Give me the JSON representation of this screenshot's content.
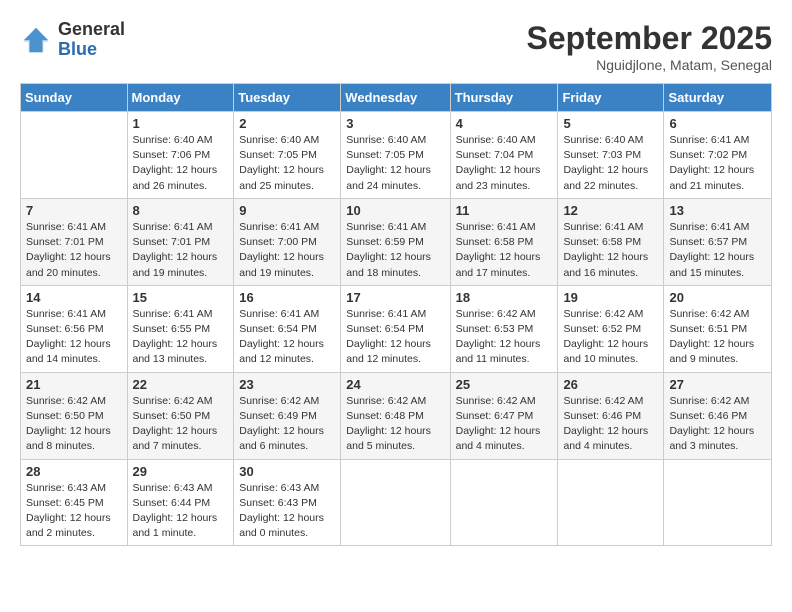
{
  "header": {
    "logo_general": "General",
    "logo_blue": "Blue",
    "month_title": "September 2025",
    "location": "Nguidjlone, Matam, Senegal"
  },
  "days_of_week": [
    "Sunday",
    "Monday",
    "Tuesday",
    "Wednesday",
    "Thursday",
    "Friday",
    "Saturday"
  ],
  "weeks": [
    [
      {
        "day": null
      },
      {
        "day": 1,
        "sunrise": "6:40 AM",
        "sunset": "7:06 PM",
        "daylight": "12 hours and 26 minutes."
      },
      {
        "day": 2,
        "sunrise": "6:40 AM",
        "sunset": "7:05 PM",
        "daylight": "12 hours and 25 minutes."
      },
      {
        "day": 3,
        "sunrise": "6:40 AM",
        "sunset": "7:05 PM",
        "daylight": "12 hours and 24 minutes."
      },
      {
        "day": 4,
        "sunrise": "6:40 AM",
        "sunset": "7:04 PM",
        "daylight": "12 hours and 23 minutes."
      },
      {
        "day": 5,
        "sunrise": "6:40 AM",
        "sunset": "7:03 PM",
        "daylight": "12 hours and 22 minutes."
      },
      {
        "day": 6,
        "sunrise": "6:41 AM",
        "sunset": "7:02 PM",
        "daylight": "12 hours and 21 minutes."
      }
    ],
    [
      {
        "day": 7,
        "sunrise": "6:41 AM",
        "sunset": "7:01 PM",
        "daylight": "12 hours and 20 minutes."
      },
      {
        "day": 8,
        "sunrise": "6:41 AM",
        "sunset": "7:01 PM",
        "daylight": "12 hours and 19 minutes."
      },
      {
        "day": 9,
        "sunrise": "6:41 AM",
        "sunset": "7:00 PM",
        "daylight": "12 hours and 19 minutes."
      },
      {
        "day": 10,
        "sunrise": "6:41 AM",
        "sunset": "6:59 PM",
        "daylight": "12 hours and 18 minutes."
      },
      {
        "day": 11,
        "sunrise": "6:41 AM",
        "sunset": "6:58 PM",
        "daylight": "12 hours and 17 minutes."
      },
      {
        "day": 12,
        "sunrise": "6:41 AM",
        "sunset": "6:58 PM",
        "daylight": "12 hours and 16 minutes."
      },
      {
        "day": 13,
        "sunrise": "6:41 AM",
        "sunset": "6:57 PM",
        "daylight": "12 hours and 15 minutes."
      }
    ],
    [
      {
        "day": 14,
        "sunrise": "6:41 AM",
        "sunset": "6:56 PM",
        "daylight": "12 hours and 14 minutes."
      },
      {
        "day": 15,
        "sunrise": "6:41 AM",
        "sunset": "6:55 PM",
        "daylight": "12 hours and 13 minutes."
      },
      {
        "day": 16,
        "sunrise": "6:41 AM",
        "sunset": "6:54 PM",
        "daylight": "12 hours and 12 minutes."
      },
      {
        "day": 17,
        "sunrise": "6:41 AM",
        "sunset": "6:54 PM",
        "daylight": "12 hours and 12 minutes."
      },
      {
        "day": 18,
        "sunrise": "6:42 AM",
        "sunset": "6:53 PM",
        "daylight": "12 hours and 11 minutes."
      },
      {
        "day": 19,
        "sunrise": "6:42 AM",
        "sunset": "6:52 PM",
        "daylight": "12 hours and 10 minutes."
      },
      {
        "day": 20,
        "sunrise": "6:42 AM",
        "sunset": "6:51 PM",
        "daylight": "12 hours and 9 minutes."
      }
    ],
    [
      {
        "day": 21,
        "sunrise": "6:42 AM",
        "sunset": "6:50 PM",
        "daylight": "12 hours and 8 minutes."
      },
      {
        "day": 22,
        "sunrise": "6:42 AM",
        "sunset": "6:50 PM",
        "daylight": "12 hours and 7 minutes."
      },
      {
        "day": 23,
        "sunrise": "6:42 AM",
        "sunset": "6:49 PM",
        "daylight": "12 hours and 6 minutes."
      },
      {
        "day": 24,
        "sunrise": "6:42 AM",
        "sunset": "6:48 PM",
        "daylight": "12 hours and 5 minutes."
      },
      {
        "day": 25,
        "sunrise": "6:42 AM",
        "sunset": "6:47 PM",
        "daylight": "12 hours and 4 minutes."
      },
      {
        "day": 26,
        "sunrise": "6:42 AM",
        "sunset": "6:46 PM",
        "daylight": "12 hours and 4 minutes."
      },
      {
        "day": 27,
        "sunrise": "6:42 AM",
        "sunset": "6:46 PM",
        "daylight": "12 hours and 3 minutes."
      }
    ],
    [
      {
        "day": 28,
        "sunrise": "6:43 AM",
        "sunset": "6:45 PM",
        "daylight": "12 hours and 2 minutes."
      },
      {
        "day": 29,
        "sunrise": "6:43 AM",
        "sunset": "6:44 PM",
        "daylight": "12 hours and 1 minute."
      },
      {
        "day": 30,
        "sunrise": "6:43 AM",
        "sunset": "6:43 PM",
        "daylight": "12 hours and 0 minutes."
      },
      {
        "day": null
      },
      {
        "day": null
      },
      {
        "day": null
      },
      {
        "day": null
      }
    ]
  ],
  "labels": {
    "sunrise": "Sunrise:",
    "sunset": "Sunset:",
    "daylight": "Daylight:"
  }
}
